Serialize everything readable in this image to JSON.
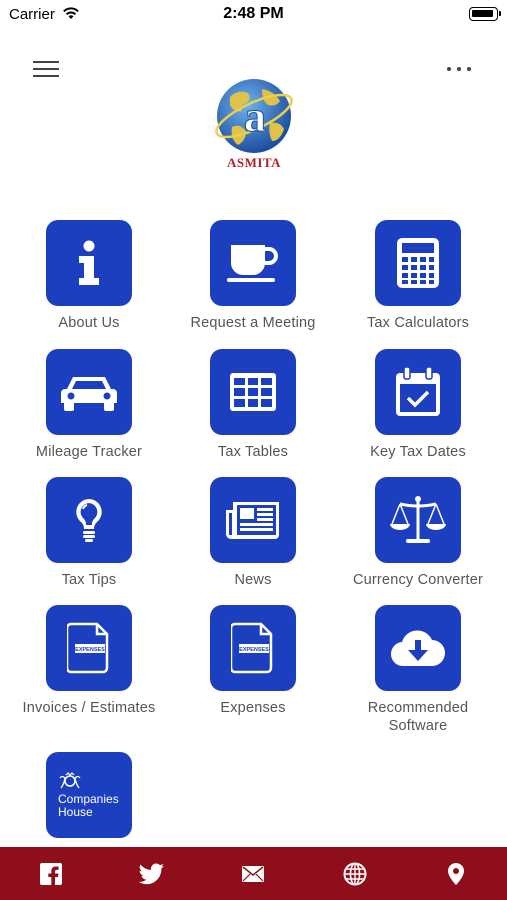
{
  "status_bar": {
    "carrier": "Carrier",
    "time": "2:48 PM"
  },
  "header": {
    "logo_text": "ASMITA"
  },
  "tiles": [
    {
      "label": "About Us",
      "icon": "info-icon"
    },
    {
      "label": "Request a Meeting",
      "icon": "coffee-cup-icon"
    },
    {
      "label": "Tax Calculators",
      "icon": "calculator-icon"
    },
    {
      "label": "Mileage Tracker",
      "icon": "car-icon"
    },
    {
      "label": "Tax Tables",
      "icon": "table-icon"
    },
    {
      "label": "Key Tax Dates",
      "icon": "calendar-check-icon"
    },
    {
      "label": "Tax Tips",
      "icon": "lightbulb-icon"
    },
    {
      "label": "News",
      "icon": "newspaper-icon"
    },
    {
      "label": "Currency Converter",
      "icon": "scales-icon"
    },
    {
      "label": "Invoices / Estimates",
      "icon": "expenses-document-icon"
    },
    {
      "label": "Expenses",
      "icon": "expenses-document-icon"
    },
    {
      "label": "Recommended Software",
      "icon": "cloud-download-icon"
    }
  ],
  "companies_house": {
    "line1": "Companies",
    "line2": "House"
  },
  "document_icon_text": "EXPENSES",
  "bottom_bar": {
    "icons": [
      "facebook-icon",
      "twitter-icon",
      "mail-icon",
      "globe-icon",
      "location-pin-icon"
    ]
  },
  "colors": {
    "tile": "#1c3fbf",
    "bottom_bar": "#8e0f1b",
    "logo_text": "#b2202a"
  }
}
